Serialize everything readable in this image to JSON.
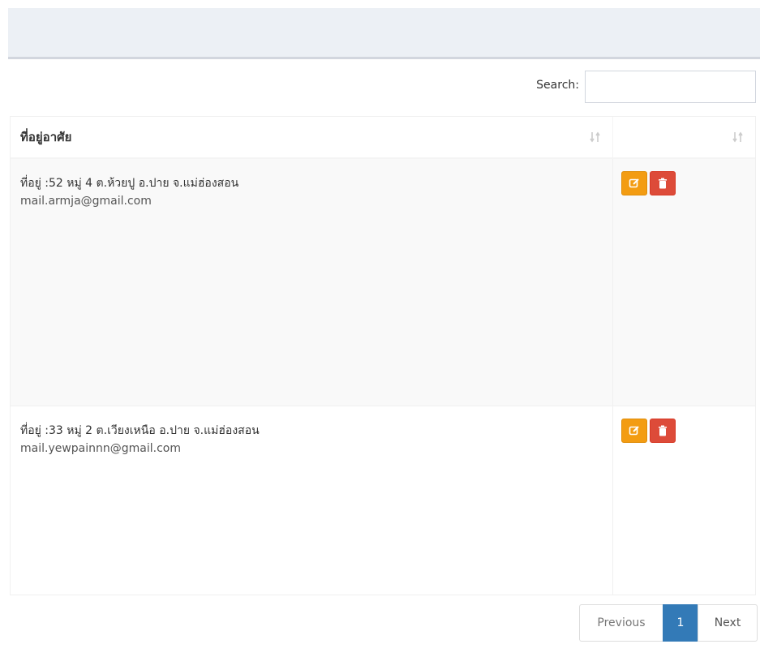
{
  "search": {
    "label": "Search:",
    "value": ""
  },
  "table": {
    "headers": [
      {
        "label": "ที่อยู่อาศัย"
      },
      {
        "label": ""
      }
    ],
    "rows": [
      {
        "address": "ที่อยู่ :52 หมู่ 4 ต.ห้วยปู อ.ปาย จ.แม่ฮ่องสอน",
        "email": "mail.armja@gmail.com"
      },
      {
        "address": "ที่อยู่ :33 หมู่ 2 ต.เวียงเหนือ อ.ปาย จ.แม่ฮ่องสอน",
        "email": "mail.yewpainnn@gmail.com"
      }
    ]
  },
  "pagination": {
    "previous": "Previous",
    "current": "1",
    "next": "Next"
  },
  "colors": {
    "edit": "#f39c12",
    "delete": "#dd4b39",
    "active_page": "#337ab7"
  },
  "icons": {
    "sort": "sort-icon",
    "edit": "edit-icon",
    "delete": "trash-icon"
  }
}
